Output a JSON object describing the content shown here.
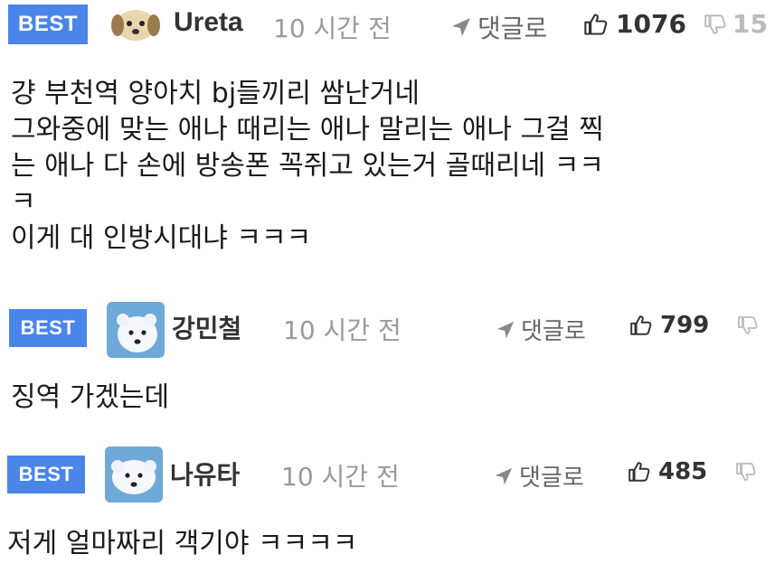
{
  "comments": [
    {
      "badge": "BEST",
      "author": "Ureta",
      "time": "10 시간 전",
      "reply_label": "댓글로",
      "likes": "1076",
      "dislikes": "15",
      "lines": [
        "걍 부천역 양아치 bj들끼리 쌈난거네",
        "그와중에 맞는 애나 때리는 애나 말리는 애나 그걸 찍",
        "는 애나 다 손에 방송폰 꼭쥐고 있는거 골때리네 ㅋㅋ",
        "ㅋ",
        "이게 대 인방시대냐 ㅋㅋㅋ"
      ]
    },
    {
      "badge": "BEST",
      "author": "강민철",
      "time": "10 시간 전",
      "reply_label": "댓글로",
      "likes": "799",
      "dislikes": "",
      "lines": [
        "징역 가겠는데"
      ]
    },
    {
      "badge": "BEST",
      "author": "나유타",
      "time": "10 시간 전",
      "reply_label": "댓글로",
      "likes": "485",
      "dislikes": "",
      "lines": [
        "저게 얼마짜리 객기야 ㅋㅋㅋㅋ"
      ]
    }
  ],
  "icons": {
    "reply": "arrow-icon",
    "like": "thumbs-up-icon",
    "dislike": "thumbs-down-icon"
  },
  "colors": {
    "badge": "#4a86e8",
    "time": "#9a9a9a",
    "dislike": "#bbbbbb"
  }
}
